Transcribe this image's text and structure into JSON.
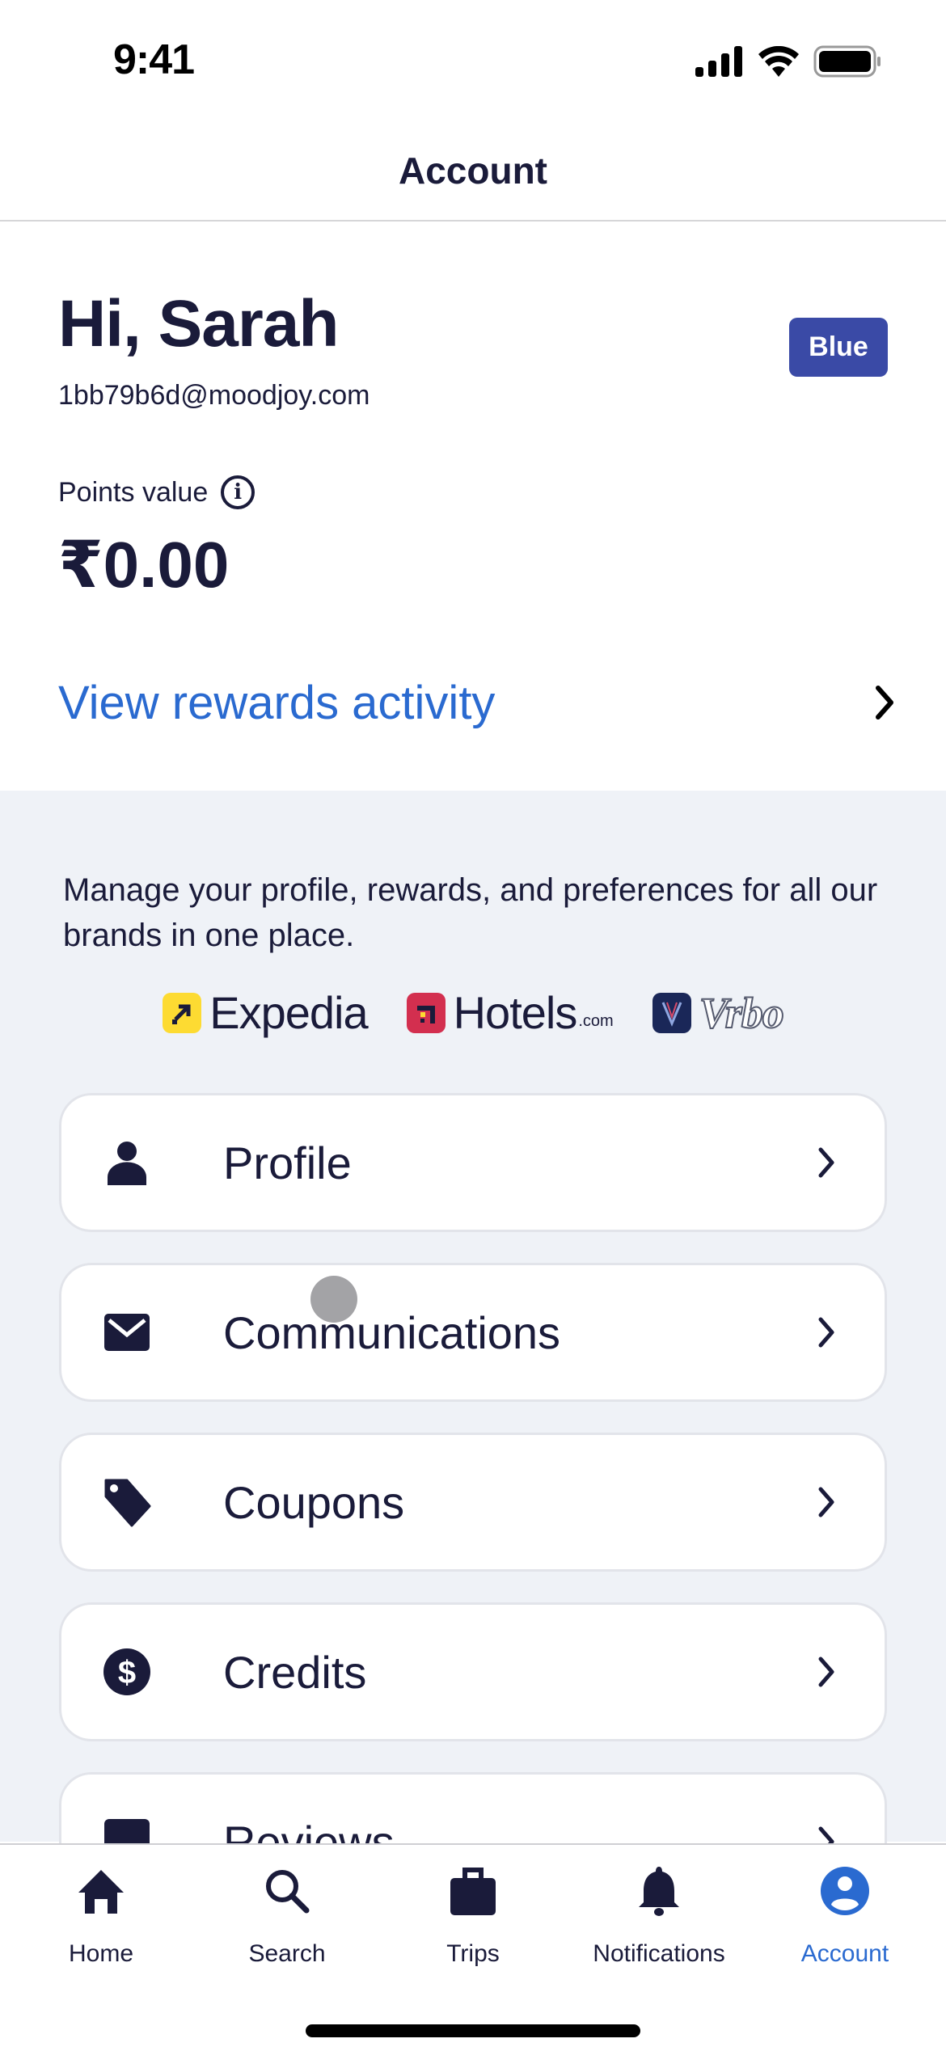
{
  "status_bar": {
    "time": "9:41"
  },
  "header": {
    "title": "Account"
  },
  "account": {
    "greeting": "Hi, Sarah",
    "email": "1bb79b6d@moodjoy.com",
    "tier_badge": "Blue",
    "points_label": "Points value",
    "points_value": "₹0.00",
    "rewards_link": "View rewards activity"
  },
  "brands_section": {
    "description": "Manage your profile, rewards, and preferences for all our brands in one place.",
    "brands": [
      {
        "name": "Expedia",
        "color": "#fddb32"
      },
      {
        "name": "Hotels",
        "suffix": ".com",
        "color": "#d32f4f"
      },
      {
        "name": "Vrbo",
        "color": "#1a2758"
      }
    ]
  },
  "menu": [
    {
      "label": "Profile",
      "icon": "person-icon"
    },
    {
      "label": "Communications",
      "icon": "mail-icon"
    },
    {
      "label": "Coupons",
      "icon": "tag-icon"
    },
    {
      "label": "Credits",
      "icon": "dollar-circle-icon"
    },
    {
      "label": "Reviews",
      "icon": "reviews-icon"
    }
  ],
  "tab_bar": {
    "tabs": [
      {
        "label": "Home",
        "icon": "home-icon",
        "active": false
      },
      {
        "label": "Search",
        "icon": "search-icon",
        "active": false
      },
      {
        "label": "Trips",
        "icon": "suitcase-icon",
        "active": false
      },
      {
        "label": "Notifications",
        "icon": "bell-icon",
        "active": false
      },
      {
        "label": "Account",
        "icon": "account-icon",
        "active": true
      }
    ]
  },
  "colors": {
    "primary_text": "#1a1b3a",
    "link_blue": "#2a6ad0",
    "badge_blue": "#3a4aa6",
    "background_grey": "#eff2f7"
  }
}
